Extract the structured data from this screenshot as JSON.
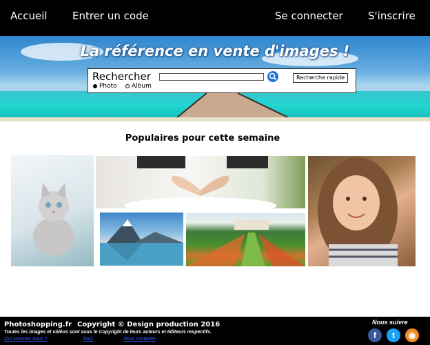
{
  "nav": {
    "home": "Accueil",
    "enter_code": "Entrer un code",
    "login": "Se connecter",
    "signup": "S'inscrire"
  },
  "hero": {
    "title": "La référence en vente d'images !"
  },
  "search": {
    "label": "Rechercher",
    "query": "",
    "quick_label": "Recherche rapide",
    "options": [
      {
        "label": "Photo",
        "selected": true
      },
      {
        "label": "Album",
        "selected": false
      }
    ]
  },
  "popular": {
    "title": "Populaires pour cette semaine",
    "images": [
      "kitten",
      "wedding-hands",
      "mountain-lake",
      "flower-garden",
      "smiling-girl"
    ]
  },
  "footer": {
    "brand": "Photoshopping.fr",
    "copyright": "Copyright © Design production 2016",
    "notice": "Toutes les images et vidéos sont sous le Copyright de leurs auteurs et éditeurs respectifs.",
    "links": [
      "Qui sommes nous ?",
      "FAQ",
      "Nous contacter"
    ],
    "follow": "Nous suivre",
    "social": [
      {
        "icon": "facebook-icon",
        "glyph": "f",
        "color": "#3b5998"
      },
      {
        "icon": "twitter-icon",
        "glyph": "t",
        "color": "#1da1f2"
      },
      {
        "icon": "rss-icon",
        "glyph": "◉",
        "color": "#f08a24"
      }
    ]
  }
}
